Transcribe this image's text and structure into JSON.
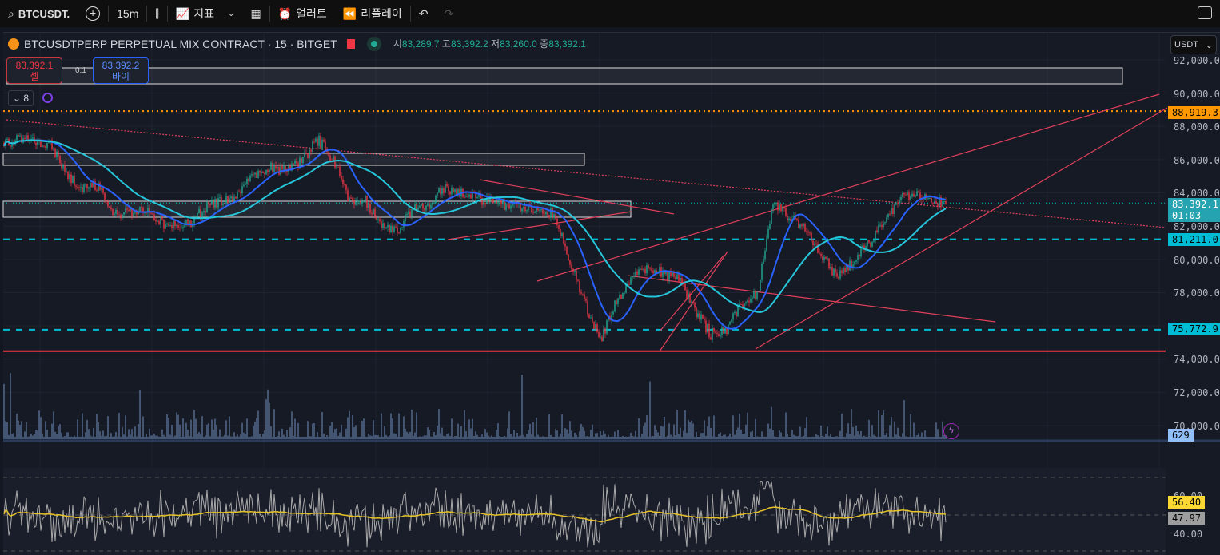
{
  "toolbar": {
    "symbol": "BTCUSDT.",
    "interval": "15m",
    "indicators": "지표",
    "alerts": "얼러트",
    "replay": "리플레이"
  },
  "legend": {
    "title": "BTCUSDTPERP PERPETUAL MIX CONTRACT · 15 · BITGET",
    "o_label": "시",
    "open": "83,289.7",
    "h_label": "고",
    "high": "83,392.2",
    "l_label": "저",
    "low": "83,260.0",
    "c_label": "종",
    "close": "83,392.1"
  },
  "trade": {
    "sell_price": "83,392.1",
    "sell_label": "셀",
    "spread": "0.1",
    "buy_price": "83,392.2",
    "buy_label": "바이"
  },
  "collapse_count": "8",
  "currency": "USDT",
  "axis": {
    "price_labels": [
      "92,000.0",
      "90,000.0",
      "88,000.0",
      "86,000.0",
      "84,000.0",
      "82,000.0",
      "80,000.0",
      "78,000.0",
      "76,000.0",
      "74,000.0",
      "72,000.0",
      "70,000.0"
    ],
    "rsi_labels": [
      "60.00",
      "40.00"
    ]
  },
  "tags": {
    "alert": "88,919.3",
    "last": "83,392.1",
    "countdown": "01:03",
    "level1": "81,211.0",
    "level2": "75,772.9",
    "volume": "629",
    "rsi": "56.40",
    "rsi_ma": "47.97"
  },
  "colors": {
    "up": "#22ab94",
    "down": "#f23645",
    "ma_fast": "#2962ff",
    "ma_slow": "#26c6da",
    "level": "#00bcd4",
    "alert": "#ff9800",
    "rsi_ma": "#e6c229"
  },
  "chart_data": {
    "type": "candlestick",
    "price_range": [
      70000,
      92000
    ],
    "levels": [
      88919.3,
      81211.0,
      75772.9,
      74480
    ],
    "path": [
      87000,
      87300,
      87100,
      86900,
      85200,
      84200,
      84400,
      82600,
      82900,
      83100,
      82200,
      82000,
      82300,
      83200,
      83500,
      84000,
      85200,
      85500,
      85300,
      86000,
      87200,
      86000,
      83400,
      83600,
      82200,
      81700,
      83000,
      83200,
      84300,
      84100,
      83700,
      83500,
      83300,
      83200,
      83000,
      82800,
      80000,
      77500,
      75000,
      77500,
      78800,
      79600,
      79100,
      78800,
      77000,
      75500,
      75800,
      77200,
      78000,
      83500,
      82600,
      81800,
      80400,
      79000,
      79800,
      80800,
      82100,
      83600,
      84000,
      83600,
      83392.1
    ]
  }
}
